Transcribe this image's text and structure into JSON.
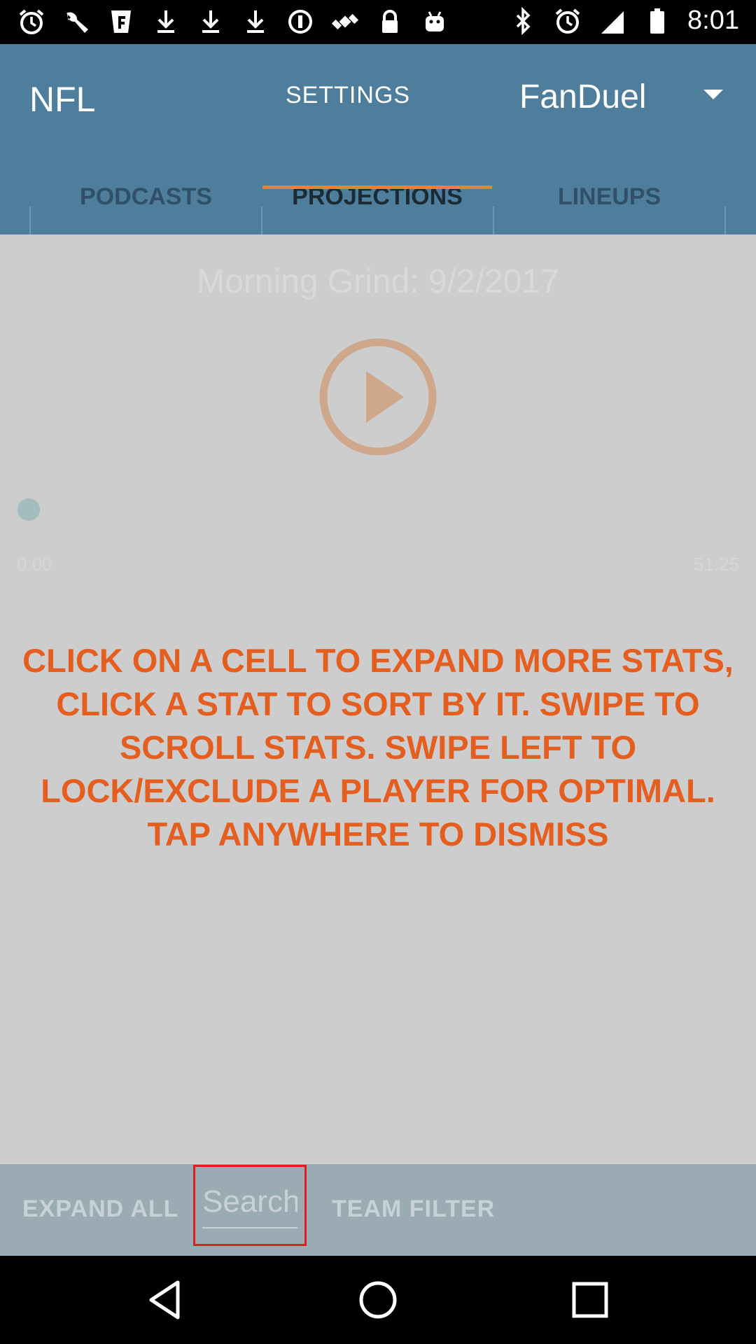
{
  "status_bar": {
    "time": "8:01",
    "left_icons": [
      "alarm-icon",
      "wrench-icon",
      "fanduel-icon",
      "download-icon",
      "download-icon",
      "download-icon",
      "data-saver-icon",
      "satellite-icon",
      "lock-icon",
      "android-icon"
    ],
    "right_icons": [
      "bluetooth-icon",
      "alarm-icon"
    ]
  },
  "app_bar": {
    "title": "NFL",
    "settings_label": "SETTINGS",
    "site_selector": "FanDuel"
  },
  "tabs": [
    {
      "label": "PODCASTS",
      "active": false
    },
    {
      "label": "PROJECTIONS",
      "active": true
    },
    {
      "label": "LINEUPS",
      "active": false
    }
  ],
  "video": {
    "title": "Morning Grind: 9/2/2017",
    "time_elapsed": "0:00",
    "time_total": "51:25"
  },
  "overlay": {
    "instructions": "CLICK ON A CELL TO EXPAND MORE STATS, CLICK A STAT TO SORT BY IT. SWIPE TO SCROLL STATS. SWIPE LEFT TO LOCK/EXCLUDE A PLAYER FOR OPTIMAL. TAP ANYWHERE TO DISMISS"
  },
  "bottom_bar": {
    "expand_all": "EXPAND ALL",
    "search_placeholder": "Search",
    "team_filter": "TEAM FILTER"
  },
  "colors": {
    "app_bar": "#4f7e9c",
    "accent": "#e8823a",
    "instructions": "#e45e20",
    "highlight_box": "#e21d1d"
  }
}
